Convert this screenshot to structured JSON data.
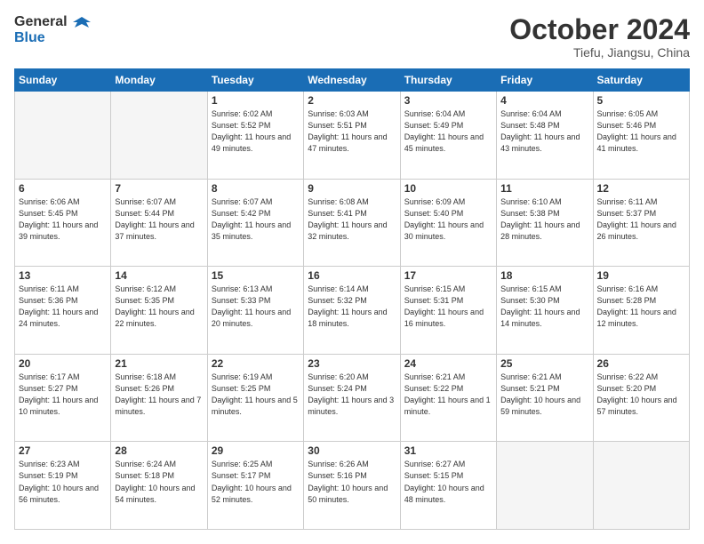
{
  "header": {
    "logo_general": "General",
    "logo_blue": "Blue",
    "month_title": "October 2024",
    "subtitle": "Tiefu, Jiangsu, China"
  },
  "days_of_week": [
    "Sunday",
    "Monday",
    "Tuesday",
    "Wednesday",
    "Thursday",
    "Friday",
    "Saturday"
  ],
  "weeks": [
    [
      {
        "num": "",
        "info": ""
      },
      {
        "num": "",
        "info": ""
      },
      {
        "num": "1",
        "info": "Sunrise: 6:02 AM\nSunset: 5:52 PM\nDaylight: 11 hours and 49 minutes."
      },
      {
        "num": "2",
        "info": "Sunrise: 6:03 AM\nSunset: 5:51 PM\nDaylight: 11 hours and 47 minutes."
      },
      {
        "num": "3",
        "info": "Sunrise: 6:04 AM\nSunset: 5:49 PM\nDaylight: 11 hours and 45 minutes."
      },
      {
        "num": "4",
        "info": "Sunrise: 6:04 AM\nSunset: 5:48 PM\nDaylight: 11 hours and 43 minutes."
      },
      {
        "num": "5",
        "info": "Sunrise: 6:05 AM\nSunset: 5:46 PM\nDaylight: 11 hours and 41 minutes."
      }
    ],
    [
      {
        "num": "6",
        "info": "Sunrise: 6:06 AM\nSunset: 5:45 PM\nDaylight: 11 hours and 39 minutes."
      },
      {
        "num": "7",
        "info": "Sunrise: 6:07 AM\nSunset: 5:44 PM\nDaylight: 11 hours and 37 minutes."
      },
      {
        "num": "8",
        "info": "Sunrise: 6:07 AM\nSunset: 5:42 PM\nDaylight: 11 hours and 35 minutes."
      },
      {
        "num": "9",
        "info": "Sunrise: 6:08 AM\nSunset: 5:41 PM\nDaylight: 11 hours and 32 minutes."
      },
      {
        "num": "10",
        "info": "Sunrise: 6:09 AM\nSunset: 5:40 PM\nDaylight: 11 hours and 30 minutes."
      },
      {
        "num": "11",
        "info": "Sunrise: 6:10 AM\nSunset: 5:38 PM\nDaylight: 11 hours and 28 minutes."
      },
      {
        "num": "12",
        "info": "Sunrise: 6:11 AM\nSunset: 5:37 PM\nDaylight: 11 hours and 26 minutes."
      }
    ],
    [
      {
        "num": "13",
        "info": "Sunrise: 6:11 AM\nSunset: 5:36 PM\nDaylight: 11 hours and 24 minutes."
      },
      {
        "num": "14",
        "info": "Sunrise: 6:12 AM\nSunset: 5:35 PM\nDaylight: 11 hours and 22 minutes."
      },
      {
        "num": "15",
        "info": "Sunrise: 6:13 AM\nSunset: 5:33 PM\nDaylight: 11 hours and 20 minutes."
      },
      {
        "num": "16",
        "info": "Sunrise: 6:14 AM\nSunset: 5:32 PM\nDaylight: 11 hours and 18 minutes."
      },
      {
        "num": "17",
        "info": "Sunrise: 6:15 AM\nSunset: 5:31 PM\nDaylight: 11 hours and 16 minutes."
      },
      {
        "num": "18",
        "info": "Sunrise: 6:15 AM\nSunset: 5:30 PM\nDaylight: 11 hours and 14 minutes."
      },
      {
        "num": "19",
        "info": "Sunrise: 6:16 AM\nSunset: 5:28 PM\nDaylight: 11 hours and 12 minutes."
      }
    ],
    [
      {
        "num": "20",
        "info": "Sunrise: 6:17 AM\nSunset: 5:27 PM\nDaylight: 11 hours and 10 minutes."
      },
      {
        "num": "21",
        "info": "Sunrise: 6:18 AM\nSunset: 5:26 PM\nDaylight: 11 hours and 7 minutes."
      },
      {
        "num": "22",
        "info": "Sunrise: 6:19 AM\nSunset: 5:25 PM\nDaylight: 11 hours and 5 minutes."
      },
      {
        "num": "23",
        "info": "Sunrise: 6:20 AM\nSunset: 5:24 PM\nDaylight: 11 hours and 3 minutes."
      },
      {
        "num": "24",
        "info": "Sunrise: 6:21 AM\nSunset: 5:22 PM\nDaylight: 11 hours and 1 minute."
      },
      {
        "num": "25",
        "info": "Sunrise: 6:21 AM\nSunset: 5:21 PM\nDaylight: 10 hours and 59 minutes."
      },
      {
        "num": "26",
        "info": "Sunrise: 6:22 AM\nSunset: 5:20 PM\nDaylight: 10 hours and 57 minutes."
      }
    ],
    [
      {
        "num": "27",
        "info": "Sunrise: 6:23 AM\nSunset: 5:19 PM\nDaylight: 10 hours and 56 minutes."
      },
      {
        "num": "28",
        "info": "Sunrise: 6:24 AM\nSunset: 5:18 PM\nDaylight: 10 hours and 54 minutes."
      },
      {
        "num": "29",
        "info": "Sunrise: 6:25 AM\nSunset: 5:17 PM\nDaylight: 10 hours and 52 minutes."
      },
      {
        "num": "30",
        "info": "Sunrise: 6:26 AM\nSunset: 5:16 PM\nDaylight: 10 hours and 50 minutes."
      },
      {
        "num": "31",
        "info": "Sunrise: 6:27 AM\nSunset: 5:15 PM\nDaylight: 10 hours and 48 minutes."
      },
      {
        "num": "",
        "info": ""
      },
      {
        "num": "",
        "info": ""
      }
    ]
  ]
}
